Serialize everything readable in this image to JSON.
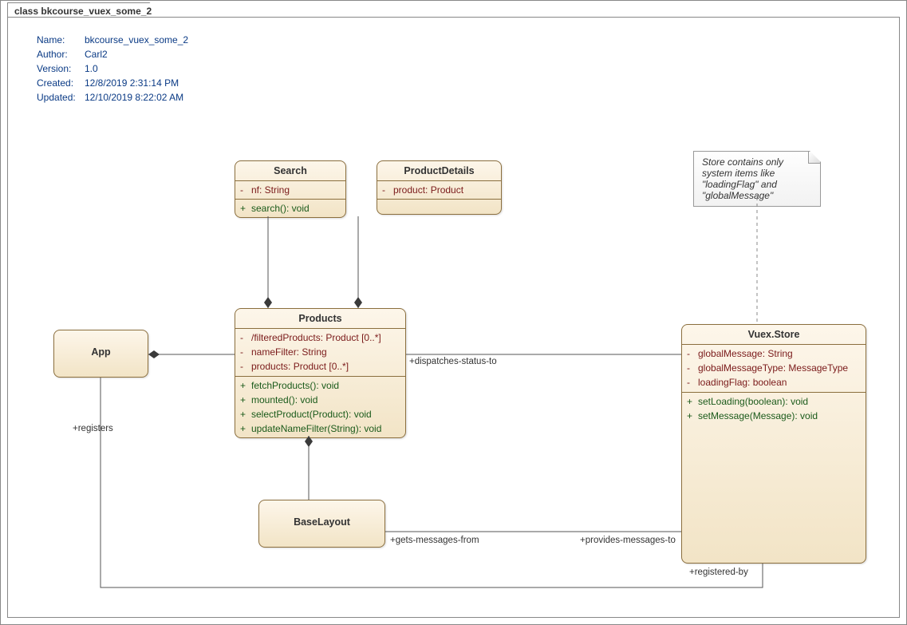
{
  "diagram": {
    "tab_label": "class bkcourse_vuex_some_2",
    "meta": {
      "name_label": "Name:",
      "name_value": "bkcourse_vuex_some_2",
      "author_label": "Author:",
      "author_value": "Carl2",
      "version_label": "Version:",
      "version_value": "1.0",
      "created_label": "Created:",
      "created_value": "12/8/2019 2:31:14 PM",
      "updated_label": "Updated:",
      "updated_value": "12/10/2019 8:22:02 AM"
    },
    "note_text": "Store contains only system items like \"loadingFlag\" and \"globalMessage\"",
    "classes": {
      "search": {
        "name": "Search",
        "attrs": [
          {
            "vis": "-",
            "text": "nf: String"
          }
        ],
        "ops": [
          {
            "vis": "+",
            "text": "search(): void"
          }
        ]
      },
      "productDetails": {
        "name": "ProductDetails",
        "attrs": [
          {
            "vis": "-",
            "text": "product: Product"
          }
        ],
        "ops": []
      },
      "products": {
        "name": "Products",
        "attrs": [
          {
            "vis": "-",
            "text": "/filteredProducts: Product [0..*]"
          },
          {
            "vis": "-",
            "text": "nameFilter: String"
          },
          {
            "vis": "-",
            "text": "products: Product [0..*]"
          }
        ],
        "ops": [
          {
            "vis": "+",
            "text": "fetchProducts(): void"
          },
          {
            "vis": "+",
            "text": "mounted(): void"
          },
          {
            "vis": "+",
            "text": "selectProduct(Product): void"
          },
          {
            "vis": "+",
            "text": "updateNameFilter(String): void"
          }
        ]
      },
      "app": {
        "name": "App"
      },
      "baseLayout": {
        "name": "BaseLayout"
      },
      "vuexStore": {
        "name": "Vuex.Store",
        "attrs": [
          {
            "vis": "-",
            "text": "globalMessage: String"
          },
          {
            "vis": "-",
            "text": "globalMessageType: MessageType"
          },
          {
            "vis": "-",
            "text": "loadingFlag: boolean"
          }
        ],
        "ops": [
          {
            "vis": "+",
            "text": "setLoading(boolean): void"
          },
          {
            "vis": "+",
            "text": "setMessage(Message): void"
          }
        ]
      }
    },
    "labels": {
      "dispatches": "+dispatches-status-to",
      "registers": "+registers",
      "getsMessages": "+gets-messages-from",
      "providesMessages": "+provides-messages-to",
      "registeredBy": "+registered-by"
    }
  }
}
